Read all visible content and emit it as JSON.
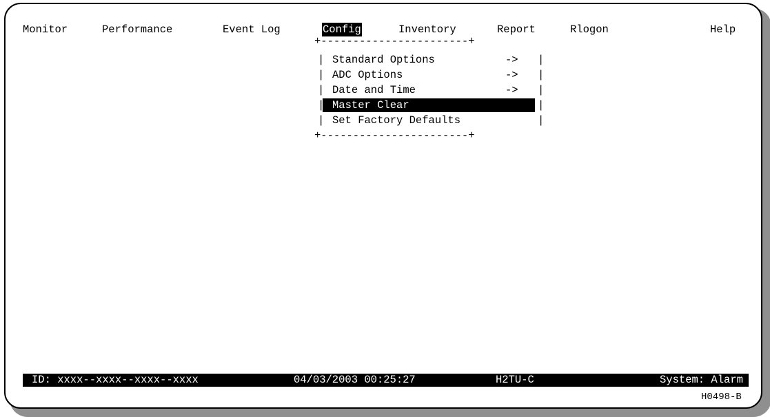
{
  "menubar": {
    "items": [
      {
        "label": "Monitor"
      },
      {
        "label": "Performance"
      },
      {
        "label": "Event Log"
      },
      {
        "label": "Config"
      },
      {
        "label": "Inventory"
      },
      {
        "label": "Report"
      },
      {
        "label": "Rlogon"
      },
      {
        "label": "Help"
      }
    ],
    "selected": "Config"
  },
  "dropdown": {
    "border_top": "+-----------------------+",
    "border_bottom": "+-----------------------+",
    "items": [
      {
        "label": "Standard Options",
        "submenu_arrow": "->"
      },
      {
        "label": "ADC Options",
        "submenu_arrow": "->"
      },
      {
        "label": "Date and Time",
        "submenu_arrow": "->"
      },
      {
        "label": "Master Clear",
        "submenu_arrow": ""
      },
      {
        "label": "Set Factory Defaults",
        "submenu_arrow": ""
      }
    ],
    "selected": "Master Clear"
  },
  "status_bar": {
    "id": "ID: xxxx--xxxx--xxxx--xxxx",
    "datetime": "04/03/2003 00:25:27",
    "unit": "H2TU-C",
    "system": "System: Alarm"
  },
  "figure_code": "H0498-B"
}
